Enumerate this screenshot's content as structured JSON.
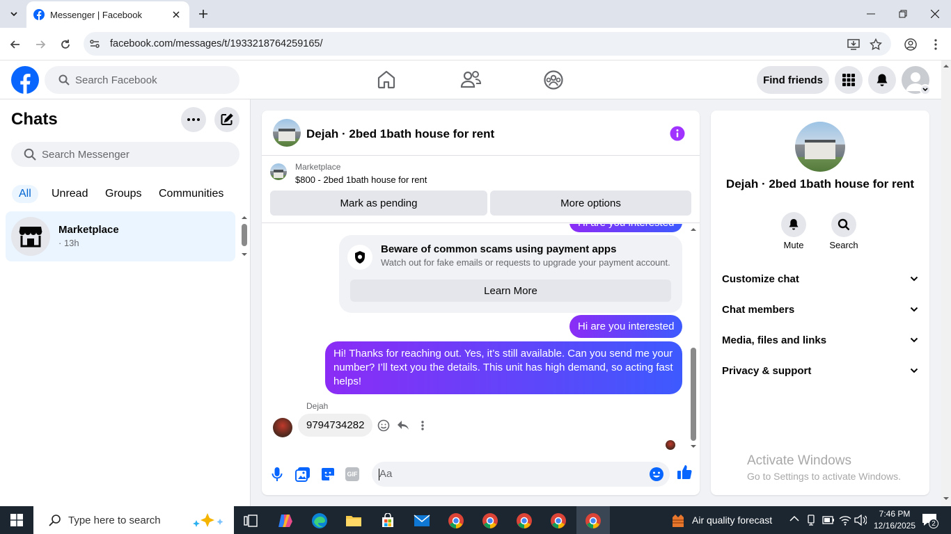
{
  "browser": {
    "tab_title": "Messenger | Facebook",
    "url": "facebook.com/messages/t/1933218764259165/"
  },
  "fb": {
    "search_placeholder": "Search Facebook",
    "find_friends": "Find friends"
  },
  "left": {
    "title": "Chats",
    "search_placeholder": "Search Messenger",
    "filters": [
      "All",
      "Unread",
      "Groups",
      "Communities"
    ],
    "chat": {
      "name": "Marketplace",
      "time": "· 13h"
    }
  },
  "conversation": {
    "title": "Dejah · 2bed 1bath house for rent",
    "marketplace_label": "Marketplace",
    "listing": "$800 - 2bed 1bath house for rent",
    "mark_pending": "Mark as pending",
    "more_options": "More options",
    "partial_bubble": "Hi are you interested",
    "scam_title": "Beware of common scams using payment apps",
    "scam_body": "Watch out for fake emails or requests to upgrade your payment account.",
    "learn_more": "Learn More",
    "msg_out_1": "Hi are you interested",
    "msg_out_2": "Hi! Thanks for reaching out. Yes, it’s still available. Can you send me your number? I’ll text you the details. This unit has high demand, so acting fast helps!",
    "sender_name": "Dejah",
    "msg_in_1": "9794734282",
    "composer_placeholder": "Aa",
    "gif_label": "GIF"
  },
  "info": {
    "title": "Dejah · 2bed 1bath house for rent",
    "mute": "Mute",
    "search": "Search",
    "rows": [
      "Customize chat",
      "Chat members",
      "Media, files and links",
      "Privacy & support"
    ],
    "watermark_title": "Activate Windows",
    "watermark_sub": "Go to Settings to activate Windows."
  },
  "taskbar": {
    "search_placeholder": "Type here to search",
    "weather": "Air quality forecast",
    "time": "7:46 PM",
    "date": "12/16/2025",
    "notif_count": "2"
  },
  "colors": {
    "fb_blue": "#0866ff",
    "bubble_gradient": [
      "#8b2cf5",
      "#3d5afe"
    ],
    "active_chat_bg": "#ebf5ff"
  }
}
